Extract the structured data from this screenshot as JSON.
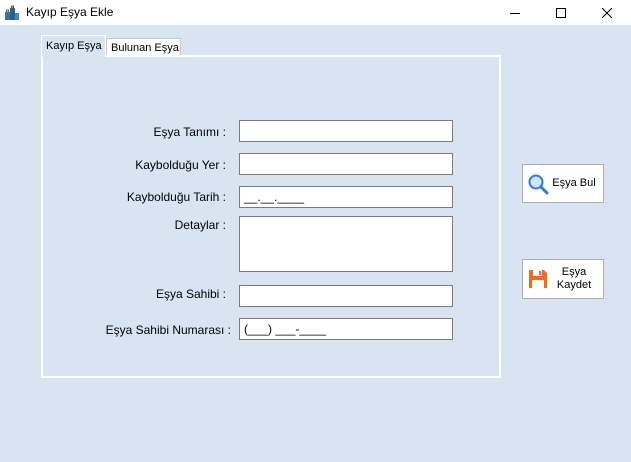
{
  "window": {
    "title": "Kayıp Eşya Ekle",
    "icon": "luggage-icon",
    "controls": [
      "minimize",
      "maximize",
      "close"
    ]
  },
  "tabs": [
    {
      "label": "Kayıp Eşya",
      "active": true
    },
    {
      "label": "Bulunan Eşya",
      "active": false
    }
  ],
  "form": {
    "esya_tanimi": {
      "label": "Eşya Tanımı :",
      "value": ""
    },
    "kayboldugu_yer": {
      "label": "Kaybolduğu Yer :",
      "value": ""
    },
    "kayboldugu_tarih": {
      "label": "Kaybolduğu Tarih :",
      "value": "__.__.____"
    },
    "detaylar": {
      "label": "Detaylar :",
      "value": ""
    },
    "esya_sahibi": {
      "label": "Eşya Sahibi :",
      "value": ""
    },
    "esya_sahibi_numarasi": {
      "label": "Eşya Sahibi Numarası :",
      "value": "(___) ___-____"
    }
  },
  "buttons": {
    "esya_bul": {
      "label": "Eşya Bul",
      "icon": "magnifier-icon"
    },
    "esya_kaydet": {
      "label": "Eşya Kaydet",
      "icon": "floppy-disk-icon"
    }
  },
  "colors": {
    "background": "#d9e4f2",
    "magnifier": "#2b7bd8",
    "save_icon": "#f26b1d"
  }
}
